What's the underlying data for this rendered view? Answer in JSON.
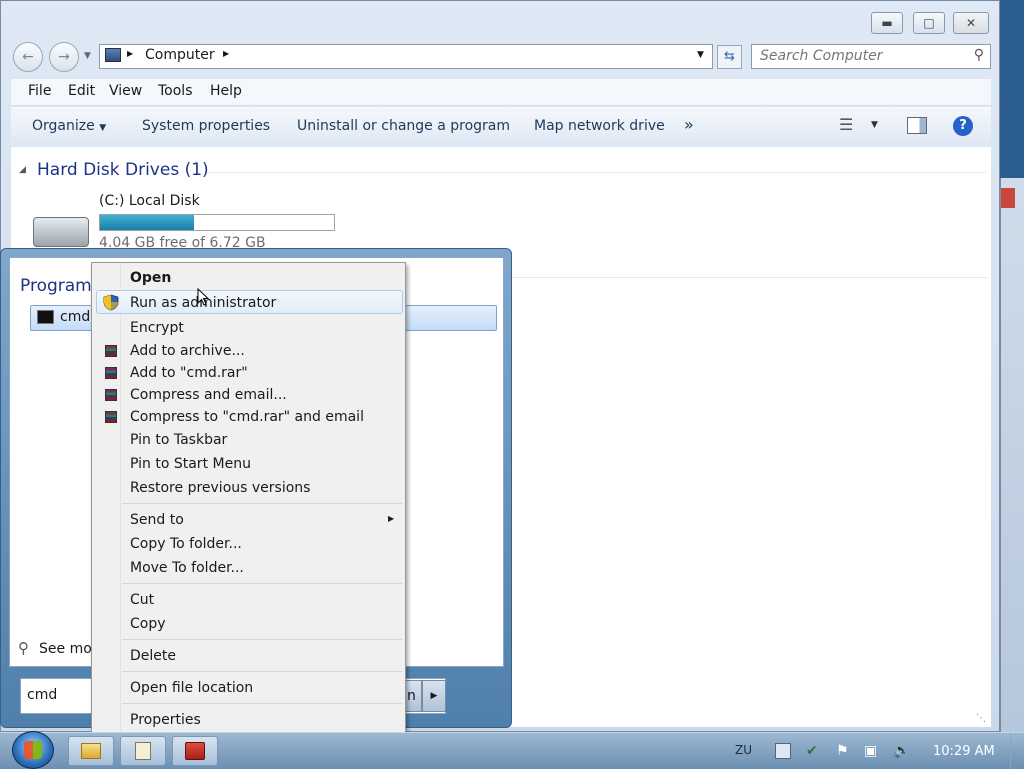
{
  "explorer": {
    "address": {
      "location": "Computer"
    },
    "search": {
      "placeholder": "Search Computer"
    },
    "menu": [
      "File",
      "Edit",
      "View",
      "Tools",
      "Help"
    ],
    "commands": [
      "Organize",
      "System properties",
      "Uninstall or change a program",
      "Map network drive"
    ],
    "section": {
      "title": "Hard Disk Drives (1)"
    },
    "drive": {
      "name": "(C:) Local Disk",
      "free_text": "4.04 GB free of 6.72 GB",
      "used_fraction": 0.4
    }
  },
  "startmenu": {
    "programs_header": "Programs",
    "result_label": "cmd.",
    "see_more": "See mo",
    "search_value": "cmd",
    "shutdown_partial": "n"
  },
  "context_menu": {
    "items": [
      {
        "label": "Open",
        "bold": true
      },
      {
        "label": "Run as administrator",
        "icon": "uac-shield-icon"
      },
      {
        "label": "Encrypt"
      },
      {
        "label": "Add to archive...",
        "icon": "winrar-icon"
      },
      {
        "label": "Add to \"cmd.rar\"",
        "icon": "winrar-icon"
      },
      {
        "label": "Compress and email...",
        "icon": "winrar-icon"
      },
      {
        "label": "Compress to \"cmd.rar\" and email",
        "icon": "winrar-icon"
      },
      {
        "label": "Pin to Taskbar"
      },
      {
        "label": "Pin to Start Menu"
      },
      {
        "label": "Restore previous versions"
      },
      {
        "label": "Send to",
        "submenu": true
      },
      {
        "label": "Copy To folder..."
      },
      {
        "label": "Move To folder..."
      },
      {
        "label": "Cut"
      },
      {
        "label": "Copy"
      },
      {
        "label": "Delete"
      },
      {
        "label": "Open file location"
      },
      {
        "label": "Properties"
      }
    ]
  },
  "taskbar": {
    "language": "ZU",
    "clock": "10:29 AM"
  },
  "colors": {
    "progress_fill": "#1f8fb6",
    "selection": "#cfe3fc",
    "accent": "#2b5d8e"
  }
}
